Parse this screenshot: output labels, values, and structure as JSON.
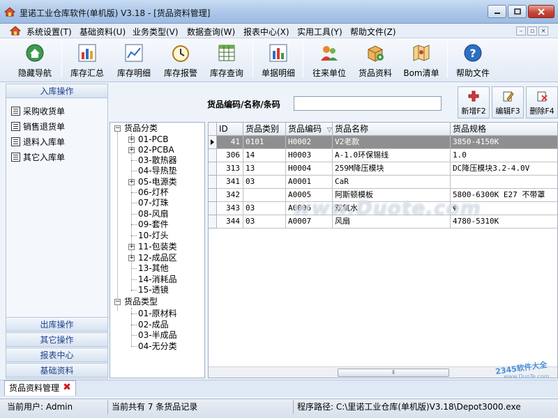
{
  "window": {
    "title": "里诺工业仓库软件(单机版) V3.18 - [货品资料管理]",
    "icon": "house-icon",
    "controls": [
      "minimize-icon",
      "maximize-icon",
      "close-icon"
    ]
  },
  "menu": {
    "items": [
      "系统设置(T)",
      "基础资料(U)",
      "业务类型(V)",
      "数据查询(W)",
      "报表中心(X)",
      "实用工具(Y)",
      "帮助文件(Z)"
    ]
  },
  "toolbar": {
    "buttons": [
      {
        "label": "隐藏导航",
        "icon": "home-refresh-icon"
      },
      {
        "label": "库存汇总",
        "icon": "bar-chart-icon"
      },
      {
        "label": "库存明细",
        "icon": "line-chart-icon"
      },
      {
        "label": "库存报警",
        "icon": "alarm-clock-icon"
      },
      {
        "label": "库存查询",
        "icon": "table-grid-icon"
      },
      {
        "label": "单据明细",
        "icon": "bar-chart-icon"
      },
      {
        "label": "往来单位",
        "icon": "people-icon"
      },
      {
        "label": "货品资料",
        "icon": "box-icon"
      },
      {
        "label": "Bom清单",
        "icon": "map-icon"
      },
      {
        "label": "帮助文件",
        "icon": "help-icon"
      }
    ]
  },
  "nav": {
    "inbound_header": "入库操作",
    "inbound_items": [
      "采购收货单",
      "销售退货单",
      "退料入库单",
      "其它入库单"
    ],
    "bottom_headers": [
      "出库操作",
      "其它操作",
      "报表中心",
      "基础资料"
    ]
  },
  "search": {
    "label": "货品编码/名称/条码",
    "value": ""
  },
  "actions": [
    {
      "label": "新增F2",
      "icon": "add-icon"
    },
    {
      "label": "编辑F3",
      "icon": "edit-icon"
    },
    {
      "label": "删除F4",
      "icon": "delete-icon"
    }
  ],
  "tree": {
    "root1": "货品分类",
    "categories": [
      {
        "label": "01-PCB",
        "expandable": true
      },
      {
        "label": "02-PCBA",
        "expandable": true
      },
      {
        "label": "03-散热器",
        "expandable": false
      },
      {
        "label": "04-导热垫",
        "expandable": false
      },
      {
        "label": "05-电源类",
        "expandable": true
      },
      {
        "label": "06-灯杯",
        "expandable": false
      },
      {
        "label": "07-灯珠",
        "expandable": false
      },
      {
        "label": "08-风扇",
        "expandable": false
      },
      {
        "label": "09-套件",
        "expandable": false
      },
      {
        "label": "10-灯头",
        "expandable": false
      },
      {
        "label": "11-包装类",
        "expandable": true
      },
      {
        "label": "12-成品区",
        "expandable": true
      },
      {
        "label": "13-其他",
        "expandable": false
      },
      {
        "label": "14-消耗品",
        "expandable": false
      },
      {
        "label": "15-透镜",
        "expandable": false
      }
    ],
    "root2": "货品类型",
    "types": [
      "01-原材料",
      "02-成品",
      "03-半成品",
      "04-无分类"
    ]
  },
  "grid": {
    "columns": [
      "ID",
      "货品类别",
      "货品编码",
      "货品名称",
      "货品规格"
    ],
    "rows": [
      [
        "41",
        "0101",
        "H0002",
        "V2老款",
        "3850-4150K"
      ],
      [
        "306",
        "14",
        "H0003",
        "A-1.0环保锡线",
        "1.0"
      ],
      [
        "313",
        "13",
        "H0004",
        "259M降压模块",
        "DC降压模块3.2-4.0V"
      ],
      [
        "341",
        "03",
        "A0001",
        "CaR",
        ""
      ],
      [
        "342",
        "",
        "A0005",
        "阿斯顿模板",
        "5800-6300K E27 不带罩"
      ],
      [
        "343",
        "03",
        "A0006",
        "双氧水",
        "Φ"
      ],
      [
        "344",
        "03",
        "A0007",
        "风扇",
        "4780-5310K"
      ]
    ],
    "selected_row": 0,
    "scroll_glyph": "⦀"
  },
  "tabs": {
    "active": "货品资料管理"
  },
  "status": {
    "user": "当前用户: Admin",
    "count": "当前共有 7 条货品记录",
    "path": "程序路径: C:\\里诺工业仓库(单机版)V3.18\\Depot3000.exe"
  },
  "watermarks": {
    "center": "www.Duote.com",
    "corner": "2345软件大全",
    "corner_sub": "www.DuoTe.com"
  },
  "colors": {
    "selected_row": "#8f8f8f",
    "nav_header_text": "#1f3f8a",
    "close_button": "#c9473a"
  }
}
